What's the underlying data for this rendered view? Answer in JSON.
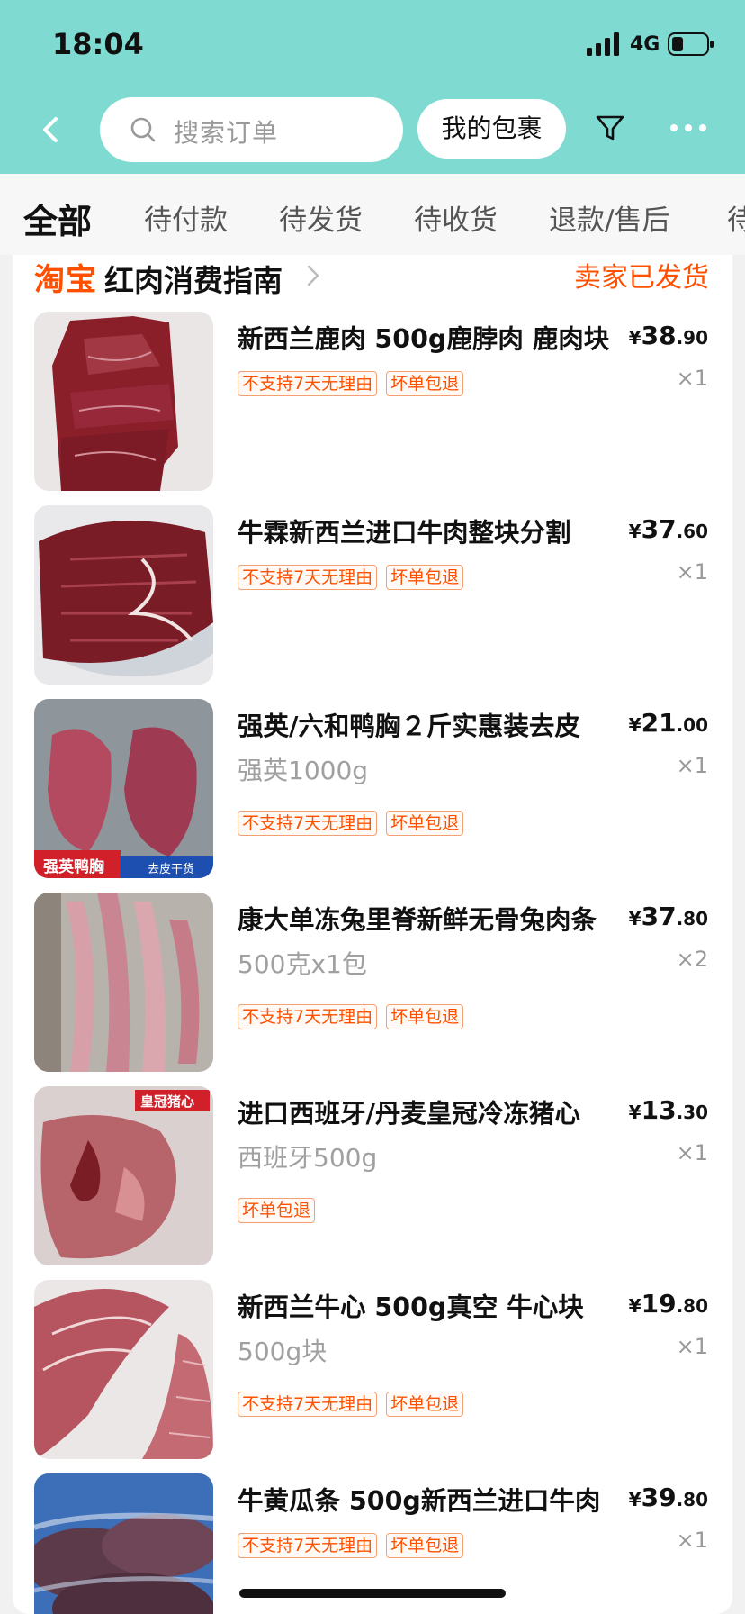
{
  "status_bar": {
    "time": "18:04",
    "network": "4G"
  },
  "nav": {
    "search_placeholder": "搜索订单",
    "package_button": "我的包裹"
  },
  "tabs": [
    "全部",
    "待付款",
    "待发货",
    "待收货",
    "退款/售后",
    "待评价"
  ],
  "active_tab": "全部",
  "order": {
    "shop_platform": "淘宝",
    "shop_name": "红肉消费指南",
    "status": "卖家已发货",
    "items": [
      {
        "title": "新西兰鹿肉 500g鹿脖肉 鹿肉块",
        "spec": "",
        "price_int": "38",
        "price_dec": ".90",
        "currency": "¥",
        "qty": "×1",
        "tags": [
          "不支持7天无理由",
          "坏单包退"
        ]
      },
      {
        "title": "牛霖新西兰进口牛肉整块分割",
        "spec": "",
        "price_int": "37",
        "price_dec": ".60",
        "currency": "¥",
        "qty": "×1",
        "tags": [
          "不支持7天无理由",
          "坏单包退"
        ]
      },
      {
        "title": "强英/六和鸭胸２斤实惠装去皮",
        "spec": "强英1000g",
        "price_int": "21",
        "price_dec": ".00",
        "currency": "¥",
        "qty": "×1",
        "tags": [
          "不支持7天无理由",
          "坏单包退"
        ],
        "thumb_labels": [
          "强英鸭胸",
          "去皮干货"
        ]
      },
      {
        "title": "康大单冻兔里脊新鲜无骨兔肉条",
        "spec": "500克x1包",
        "price_int": "37",
        "price_dec": ".80",
        "currency": "¥",
        "qty": "×2",
        "tags": [
          "不支持7天无理由",
          "坏单包退"
        ]
      },
      {
        "title": "进口西班牙/丹麦皇冠冷冻猪心",
        "spec": "西班牙500g",
        "price_int": "13",
        "price_dec": ".30",
        "currency": "¥",
        "qty": "×1",
        "tags": [
          "坏单包退"
        ],
        "thumb_labels": [
          "皇冠猪心"
        ]
      },
      {
        "title": "新西兰牛心 500g真空 牛心块",
        "spec": "500g块",
        "price_int": "19",
        "price_dec": ".80",
        "currency": "¥",
        "qty": "×1",
        "tags": [
          "不支持7天无理由",
          "坏单包退"
        ]
      },
      {
        "title": "牛黄瓜条 500g新西兰进口牛肉",
        "spec": "",
        "price_int": "39",
        "price_dec": ".80",
        "currency": "¥",
        "qty": "×1",
        "tags": [
          "不支持7天无理由",
          "坏单包退"
        ]
      }
    ]
  },
  "colors": {
    "header": "#7fdbd2",
    "accent": "#ff5000",
    "tag_border": "#f5a072"
  }
}
